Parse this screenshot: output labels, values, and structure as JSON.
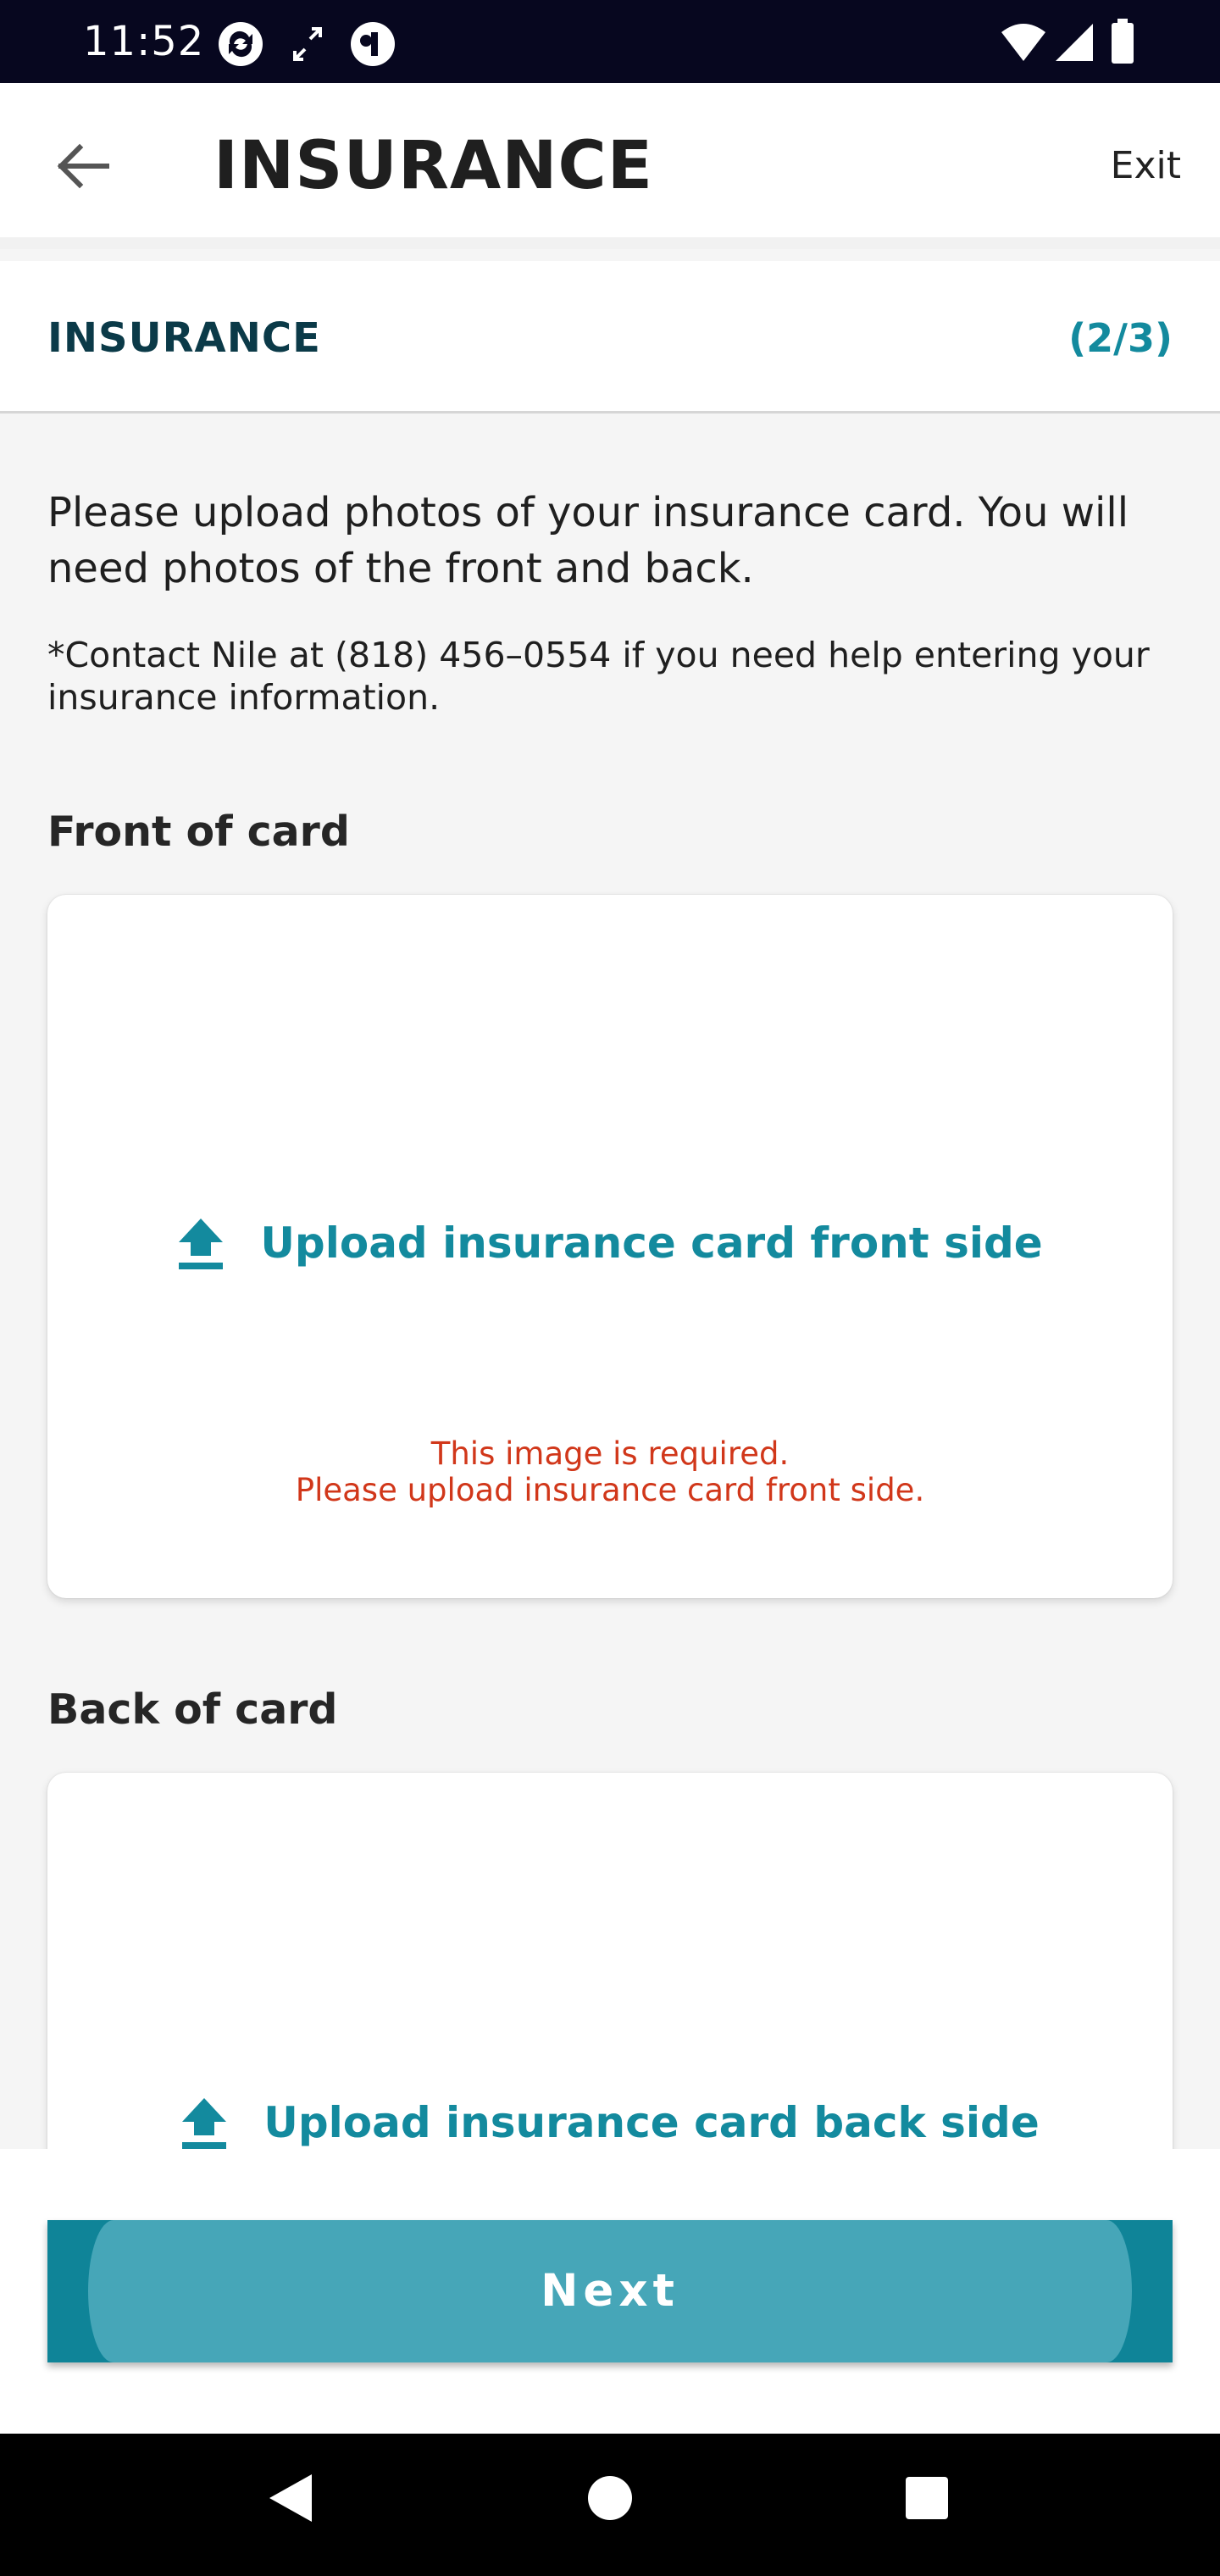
{
  "status_bar": {
    "time": "11:52",
    "icons": [
      "sync-icon",
      "expand-arrows-icon",
      "app-badge-icon",
      "wifi-icon",
      "signal-icon",
      "battery-icon"
    ]
  },
  "app_bar": {
    "title": "INSURANCE",
    "exit_label": "Exit",
    "back_icon": "arrow-left-icon"
  },
  "section": {
    "label": "INSURANCE",
    "step": "(2/3)"
  },
  "intro": {
    "text": "Please upload photos of your insurance card. You will need photos of the front and back.",
    "contact": "*Contact Nile at (818) 456–0554 if you need help entering your insurance information."
  },
  "front": {
    "label": "Front of card",
    "upload_label": "Upload insurance card front side",
    "error_line1": "This image is required.",
    "error_line2": "Please upload insurance card front side."
  },
  "back": {
    "label": "Back of card",
    "upload_label": "Upload insurance card back side"
  },
  "next_button": {
    "label": "Next"
  },
  "colors": {
    "accent": "#138a9e",
    "heading": "#0b3a48",
    "error": "#d1371a",
    "button": "#46a6b8",
    "status_bar": "#07071f"
  },
  "nav_bar": {
    "icons": [
      "back-triangle-icon",
      "home-circle-icon",
      "recents-square-icon"
    ]
  }
}
